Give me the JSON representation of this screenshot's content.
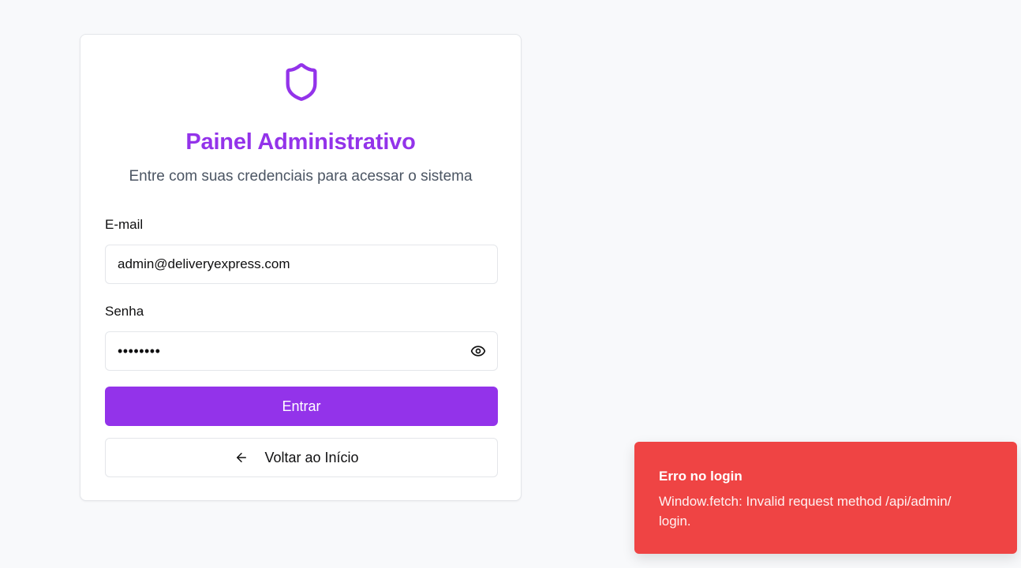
{
  "login": {
    "title": "Painel Administrativo",
    "subtitle": "Entre com suas credenciais para acessar o sistema",
    "email_label": "E-mail",
    "email_value": "admin@deliveryexpress.com",
    "password_label": "Senha",
    "password_masked": "••••••••",
    "submit_label": "Entrar",
    "back_label": "Voltar ao Início"
  },
  "icons": {
    "logo": "shield-icon",
    "password_toggle": "eye-icon",
    "back": "arrow-left-icon"
  },
  "toast": {
    "title": "Erro no login",
    "message": "Window.fetch: Invalid request method /api/admin/ login."
  },
  "colors": {
    "accent": "#9333ea",
    "error": "#ef4444",
    "background": "#f8f9fb"
  }
}
